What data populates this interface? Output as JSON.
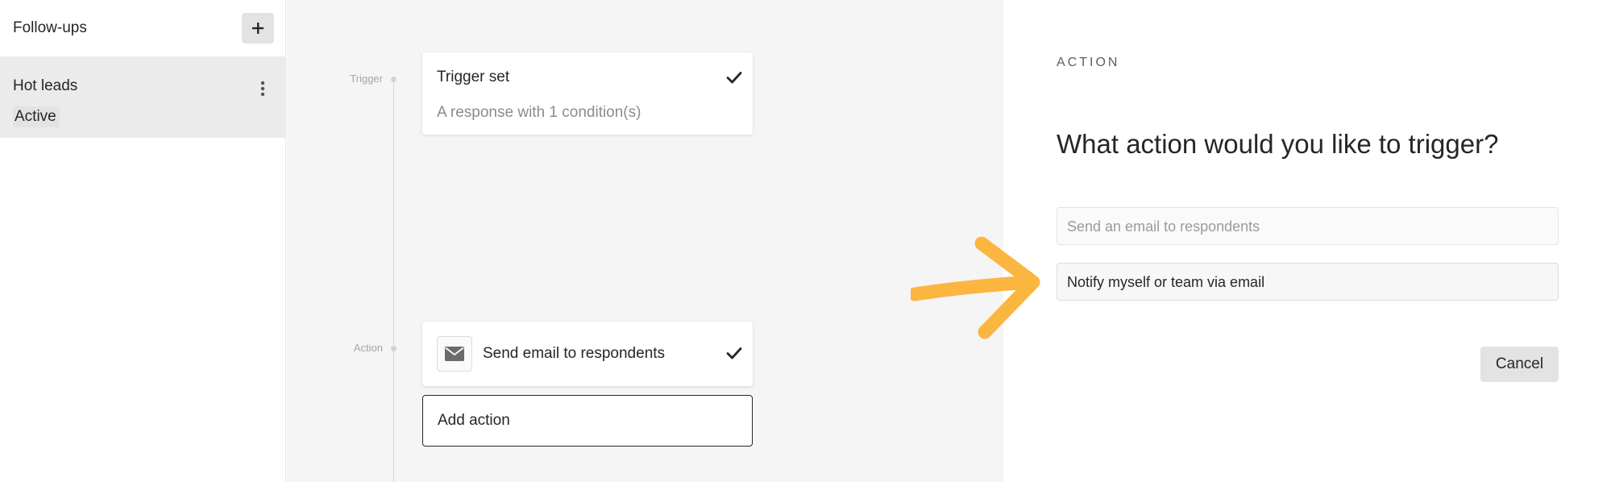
{
  "sidebar": {
    "title": "Follow-ups",
    "add_icon": "plus-icon",
    "items": [
      {
        "name": "Hot leads",
        "status": "Active",
        "menu_icon": "kebab-menu-icon"
      }
    ]
  },
  "canvas": {
    "timeline": {
      "trigger_label": "Trigger",
      "action_label": "Action"
    },
    "trigger_card": {
      "title": "Trigger set",
      "subtitle": "A response with 1 condition(s)",
      "status_icon": "checkmark-icon"
    },
    "action_card": {
      "icon": "envelope-icon",
      "title": "Send email to respondents",
      "status_icon": "checkmark-icon"
    },
    "add_action": {
      "label": "Add action"
    }
  },
  "panel": {
    "eyebrow": "ACTION",
    "question": "What action would you like to trigger?",
    "options": [
      {
        "label": "Send an email to respondents"
      },
      {
        "label": "Notify myself or team via email"
      }
    ],
    "cancel_label": "Cancel"
  },
  "annotation": {
    "arrow_icon": "arrow-right-icon",
    "arrow_color": "#FBB640"
  }
}
